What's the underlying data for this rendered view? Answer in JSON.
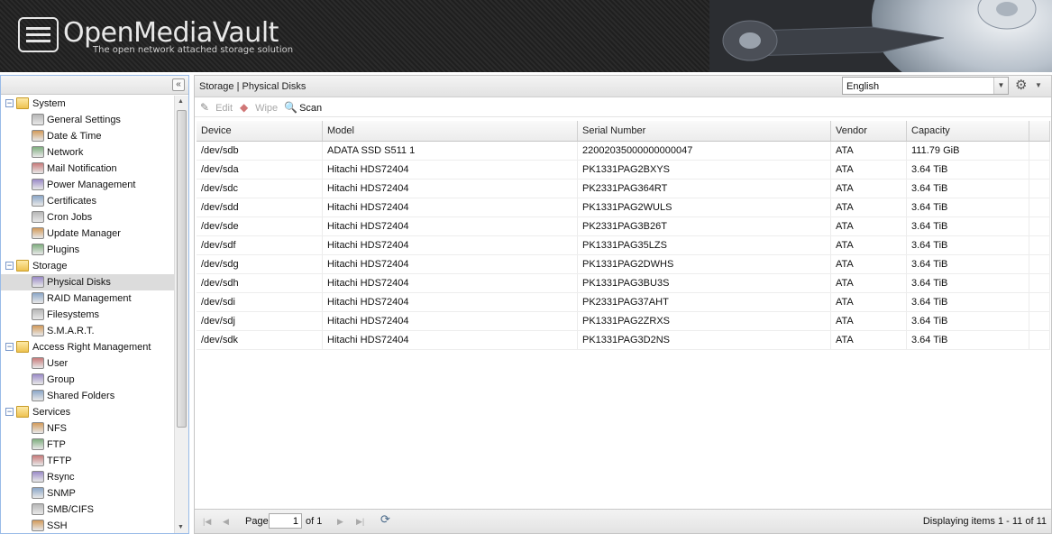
{
  "header": {
    "brand": "OpenMediaVault",
    "tagline": "The open network attached storage solution"
  },
  "sidebar": {
    "collapse_glyph": "«",
    "tree": [
      {
        "label": "System",
        "level": 0,
        "type": "folder"
      },
      {
        "label": "General Settings",
        "level": 1,
        "icon": "wrench-icon"
      },
      {
        "label": "Date & Time",
        "level": 1,
        "icon": "clock-icon"
      },
      {
        "label": "Network",
        "level": 1,
        "icon": "network-icon"
      },
      {
        "label": "Mail Notification",
        "level": 1,
        "icon": "mail-icon"
      },
      {
        "label": "Power Management",
        "level": 1,
        "icon": "power-icon"
      },
      {
        "label": "Certificates",
        "level": 1,
        "icon": "certificate-icon"
      },
      {
        "label": "Cron Jobs",
        "level": 1,
        "icon": "cron-icon"
      },
      {
        "label": "Update Manager",
        "level": 1,
        "icon": "update-icon"
      },
      {
        "label": "Plugins",
        "level": 1,
        "icon": "plugin-icon"
      },
      {
        "label": "Storage",
        "level": 0,
        "type": "folder"
      },
      {
        "label": "Physical Disks",
        "level": 1,
        "icon": "disk-icon",
        "selected": true
      },
      {
        "label": "RAID Management",
        "level": 1,
        "icon": "raid-icon"
      },
      {
        "label": "Filesystems",
        "level": 1,
        "icon": "filesystem-icon"
      },
      {
        "label": "S.M.A.R.T.",
        "level": 1,
        "icon": "smart-icon"
      },
      {
        "label": "Access Right Management",
        "level": 0,
        "type": "folder"
      },
      {
        "label": "User",
        "level": 1,
        "icon": "user-icon"
      },
      {
        "label": "Group",
        "level": 1,
        "icon": "group-icon"
      },
      {
        "label": "Shared Folders",
        "level": 1,
        "icon": "shared-folder-icon"
      },
      {
        "label": "Services",
        "level": 0,
        "type": "folder"
      },
      {
        "label": "NFS",
        "level": 1,
        "icon": "nfs-icon"
      },
      {
        "label": "FTP",
        "level": 1,
        "icon": "ftp-icon"
      },
      {
        "label": "TFTP",
        "level": 1,
        "icon": "tftp-icon"
      },
      {
        "label": "Rsync",
        "level": 1,
        "icon": "rsync-icon"
      },
      {
        "label": "SNMP",
        "level": 1,
        "icon": "snmp-icon"
      },
      {
        "label": "SMB/CIFS",
        "level": 1,
        "icon": "smb-icon"
      },
      {
        "label": "SSH",
        "level": 1,
        "icon": "ssh-icon"
      }
    ]
  },
  "main": {
    "breadcrumb": "Storage | Physical Disks",
    "language": {
      "value": "English"
    },
    "toolbar": {
      "edit": "Edit",
      "wipe": "Wipe",
      "scan": "Scan"
    },
    "grid": {
      "columns": [
        "Device",
        "Model",
        "Serial Number",
        "Vendor",
        "Capacity"
      ],
      "rows": [
        [
          "/dev/sdb",
          "ADATA SSD S511 1",
          "22002035000000000047",
          "ATA",
          "111.79 GiB"
        ],
        [
          "/dev/sda",
          "Hitachi HDS72404",
          "PK1331PAG2BXYS",
          "ATA",
          "3.64 TiB"
        ],
        [
          "/dev/sdc",
          "Hitachi HDS72404",
          "PK2331PAG364RT",
          "ATA",
          "3.64 TiB"
        ],
        [
          "/dev/sdd",
          "Hitachi HDS72404",
          "PK1331PAG2WULS",
          "ATA",
          "3.64 TiB"
        ],
        [
          "/dev/sde",
          "Hitachi HDS72404",
          "PK2331PAG3B26T",
          "ATA",
          "3.64 TiB"
        ],
        [
          "/dev/sdf",
          "Hitachi HDS72404",
          "PK1331PAG35LZS",
          "ATA",
          "3.64 TiB"
        ],
        [
          "/dev/sdg",
          "Hitachi HDS72404",
          "PK1331PAG2DWHS",
          "ATA",
          "3.64 TiB"
        ],
        [
          "/dev/sdh",
          "Hitachi HDS72404",
          "PK1331PAG3BU3S",
          "ATA",
          "3.64 TiB"
        ],
        [
          "/dev/sdi",
          "Hitachi HDS72404",
          "PK2331PAG37AHT",
          "ATA",
          "3.64 TiB"
        ],
        [
          "/dev/sdj",
          "Hitachi HDS72404",
          "PK1331PAG2ZRXS",
          "ATA",
          "3.64 TiB"
        ],
        [
          "/dev/sdk",
          "Hitachi HDS72404",
          "PK1331PAG3D2NS",
          "ATA",
          "3.64 TiB"
        ]
      ]
    },
    "pager": {
      "page_label": "Page",
      "page_value": "1",
      "of_label": "of 1",
      "status": "Displaying items 1 - 11 of 11"
    }
  }
}
